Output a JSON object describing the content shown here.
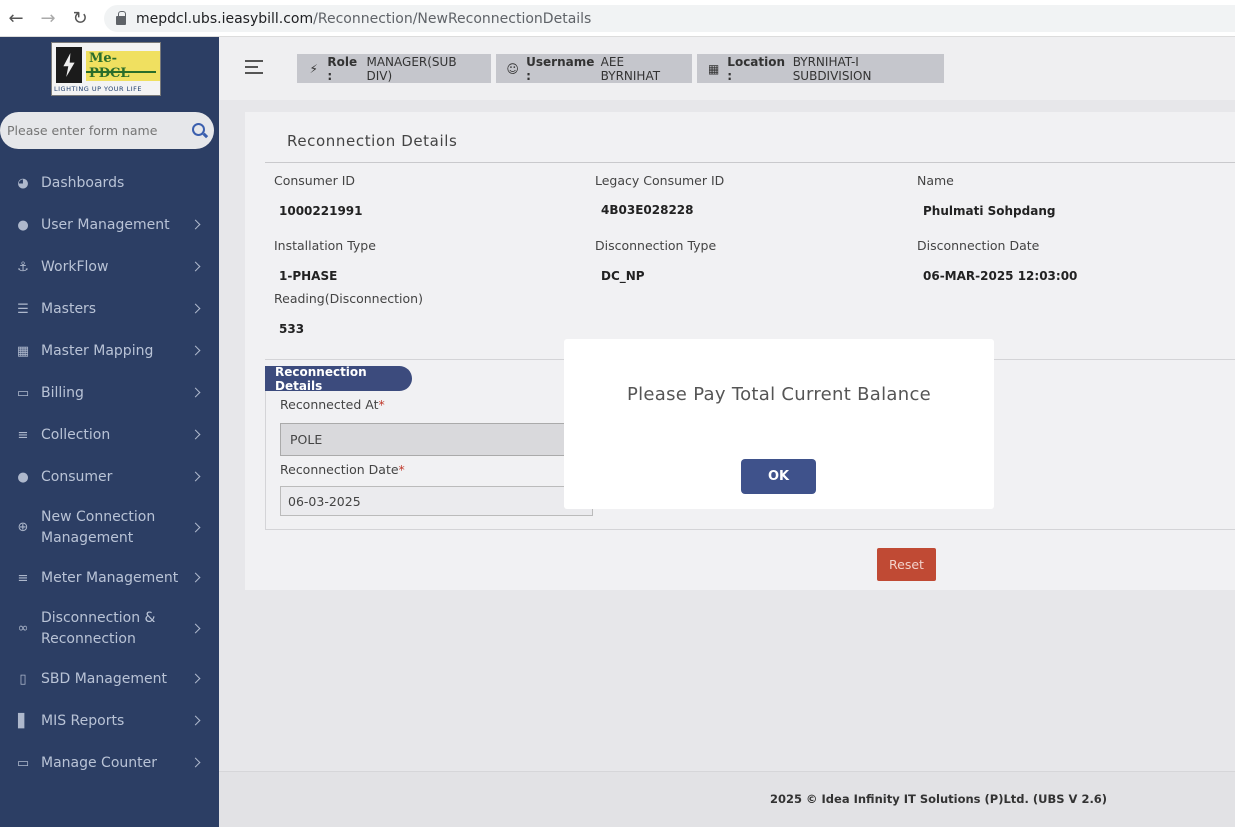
{
  "browser": {
    "url_host": "mepdcl.ubs.ieasybill.com",
    "url_path": "/Reconnection/NewReconnectionDetails"
  },
  "sidebar": {
    "logo_text": "Me-PDCL",
    "logo_tagline": "LIGHTING UP YOUR LIFE",
    "search_placeholder": "Please enter form name",
    "items": [
      {
        "label": "Dashboards",
        "icon": "dashboard-icon"
      },
      {
        "label": "User Management",
        "icon": "user-icon"
      },
      {
        "label": "WorkFlow",
        "icon": "anchor-icon"
      },
      {
        "label": "Masters",
        "icon": "layers-icon"
      },
      {
        "label": "Master Mapping",
        "icon": "sitemap-icon"
      },
      {
        "label": "Billing",
        "icon": "monitor-icon"
      },
      {
        "label": "Collection",
        "icon": "list-icon"
      },
      {
        "label": "Consumer",
        "icon": "user-icon"
      },
      {
        "label": "New Connection Management",
        "icon": "plus-circle-icon"
      },
      {
        "label": "Meter Management",
        "icon": "list-icon"
      },
      {
        "label": "Disconnection & Reconnection",
        "icon": "link-icon"
      },
      {
        "label": "SBD Management",
        "icon": "mobile-icon"
      },
      {
        "label": "MIS Reports",
        "icon": "bar-chart-icon"
      },
      {
        "label": "Manage Counter",
        "icon": "monitor-icon"
      }
    ]
  },
  "topbar": {
    "role_label": "Role :",
    "role_value": "MANAGER(SUB DIV)",
    "username_label": "Username :",
    "username_value": "AEE BYRNIHAT",
    "location_label": "Location :",
    "location_value": "BYRNIHAT-I SUBDIVISION"
  },
  "details": {
    "title": "Reconnection Details",
    "fields": {
      "consumer_id_label": "Consumer ID",
      "consumer_id": "1000221991",
      "legacy_id_label": "Legacy Consumer ID",
      "legacy_id": "4B03E028228",
      "name_label": "Name",
      "name": "Phulmati Sohpdang",
      "installation_type_label": "Installation Type",
      "installation_type": "1-PHASE",
      "disconnection_type_label": "Disconnection Type",
      "disconnection_type": "DC_NP",
      "disconnection_date_label": "Disconnection Date",
      "disconnection_date": "06-MAR-2025 12:03:00",
      "reading_label": "Reading(Disconnection)",
      "reading": "533"
    }
  },
  "reconnection_form": {
    "section_title": "Reconnection Details",
    "reconnected_at_label": "Reconnected At",
    "reconnected_at_value": "POLE",
    "reconnection_date_label": "Reconnection Date",
    "reconnection_date_value": "06-03-2025",
    "required_mark": "*",
    "reset_label": "Reset"
  },
  "modal": {
    "message": "Please Pay Total Current Balance",
    "ok_label": "OK"
  },
  "footer": {
    "text": "2025 © Idea Infinity IT Solutions (P)Ltd. (UBS V 2.6)"
  }
}
